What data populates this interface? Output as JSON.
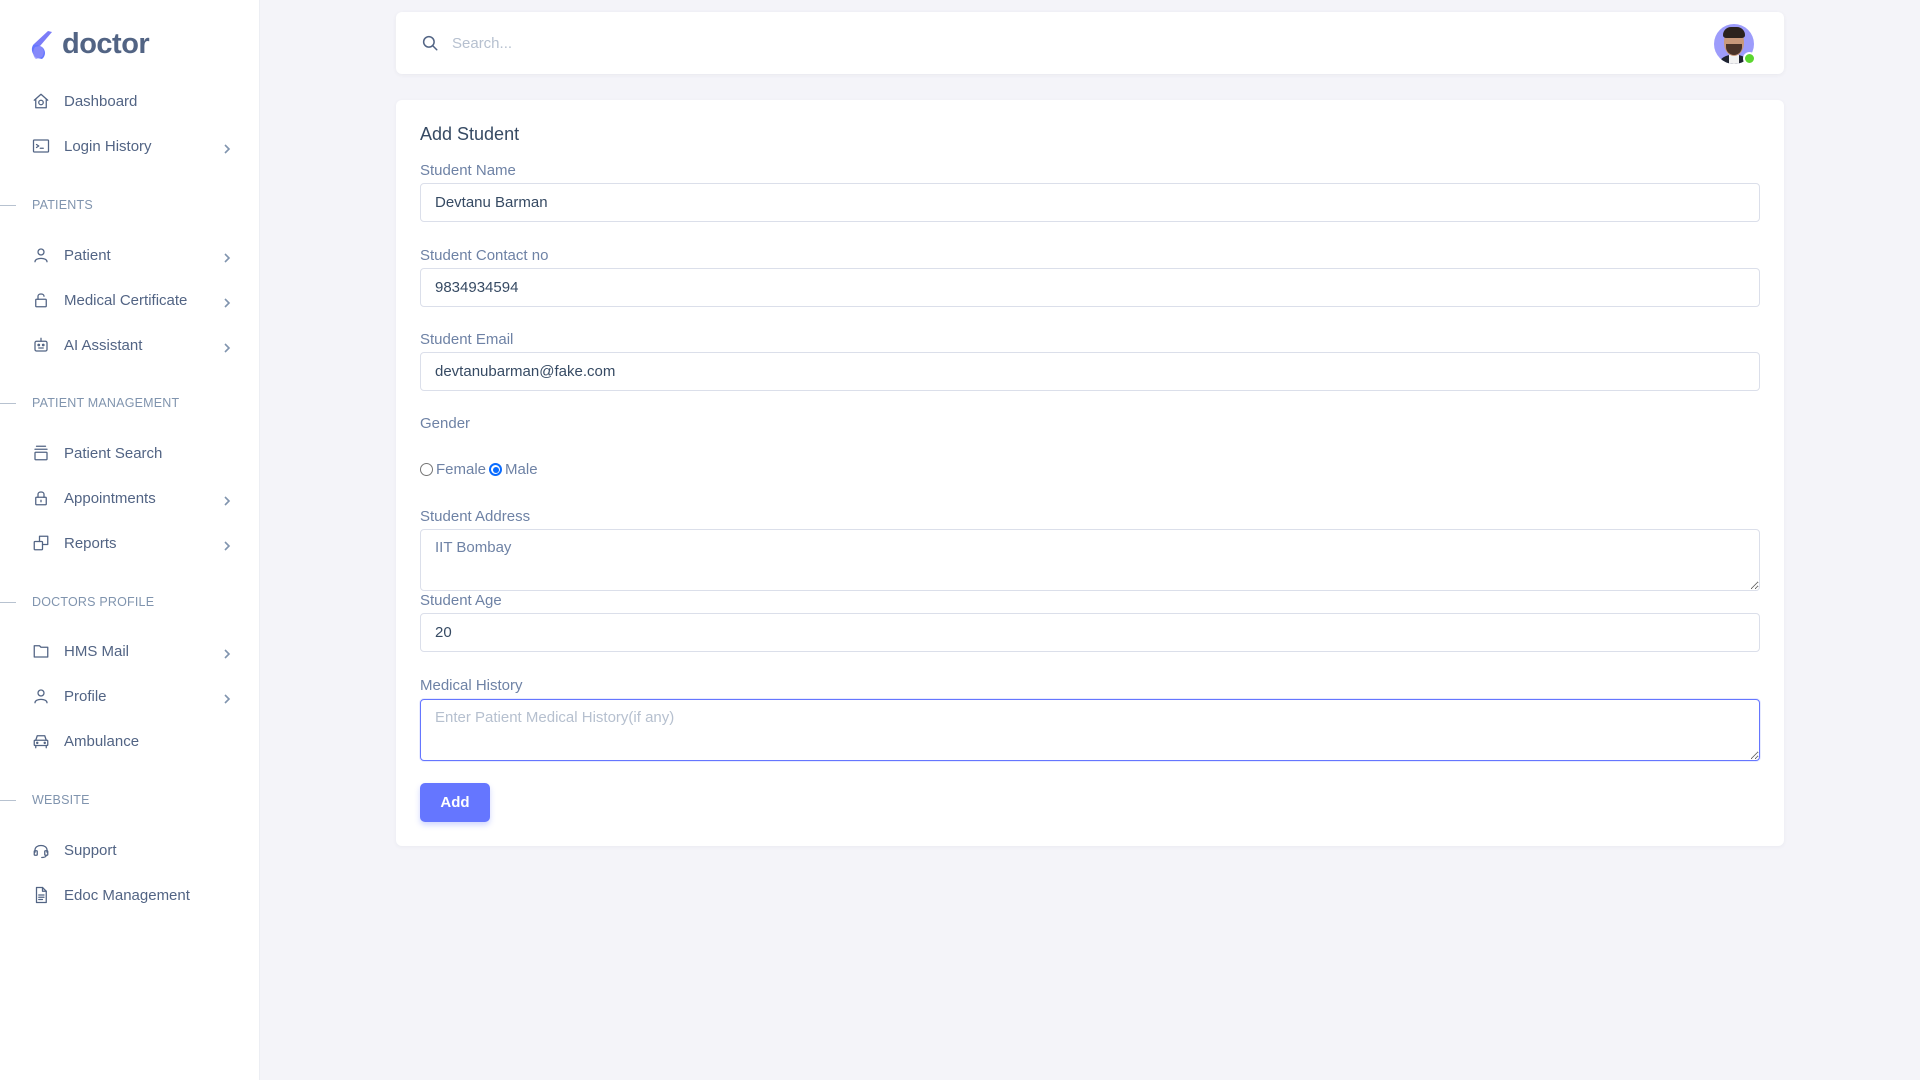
{
  "brand": {
    "name": "doctor",
    "accent": "#6576ff"
  },
  "sidebar": {
    "top_items": [
      {
        "label": "Dashboard",
        "icon": "home-icon",
        "has_chevron": false
      },
      {
        "label": "Login History",
        "icon": "terminal-icon",
        "has_chevron": true
      }
    ],
    "sections": [
      {
        "heading": "PATIENTS",
        "items": [
          {
            "label": "Patient",
            "icon": "user-icon",
            "has_chevron": true
          },
          {
            "label": "Medical Certificate",
            "icon": "lock-open-icon",
            "has_chevron": true
          },
          {
            "label": "AI Assistant",
            "icon": "robot-icon",
            "has_chevron": true
          }
        ]
      },
      {
        "heading": "PATIENT MANAGEMENT",
        "items": [
          {
            "label": "Patient Search",
            "icon": "tray-icon",
            "has_chevron": false
          },
          {
            "label": "Appointments",
            "icon": "lock-icon",
            "has_chevron": true
          },
          {
            "label": "Reports",
            "icon": "copy-icon",
            "has_chevron": true
          }
        ]
      },
      {
        "heading": "DOCTORS PROFILE",
        "items": [
          {
            "label": "HMS Mail",
            "icon": "folder-icon",
            "has_chevron": true
          },
          {
            "label": "Profile",
            "icon": "user-icon",
            "has_chevron": true
          },
          {
            "label": "Ambulance",
            "icon": "car-icon",
            "has_chevron": false
          }
        ]
      },
      {
        "heading": "WEBSITE",
        "items": [
          {
            "label": "Support",
            "icon": "headphones-icon",
            "has_chevron": false
          },
          {
            "label": "Edoc Management",
            "icon": "document-icon",
            "has_chevron": false
          }
        ]
      }
    ]
  },
  "header": {
    "search_placeholder": "Search...",
    "user_status": "online"
  },
  "form": {
    "title": "Add Student",
    "fields": {
      "name": {
        "label": "Student Name",
        "value": "Devtanu Barman"
      },
      "contact": {
        "label": "Student Contact no",
        "value": "9834934594"
      },
      "email": {
        "label": "Student Email",
        "value": "devtanubarman@fake.com"
      },
      "gender": {
        "label": "Gender",
        "options": [
          "Female",
          "Male"
        ],
        "selected": "Male"
      },
      "address": {
        "label": "Student Address",
        "value": "IIT Bombay"
      },
      "age": {
        "label": "Student Age",
        "value": "20"
      },
      "medical_history": {
        "label": "Medical History",
        "value": "",
        "placeholder": "Enter Patient Medical History(if any)"
      }
    },
    "submit_label": "Add"
  }
}
